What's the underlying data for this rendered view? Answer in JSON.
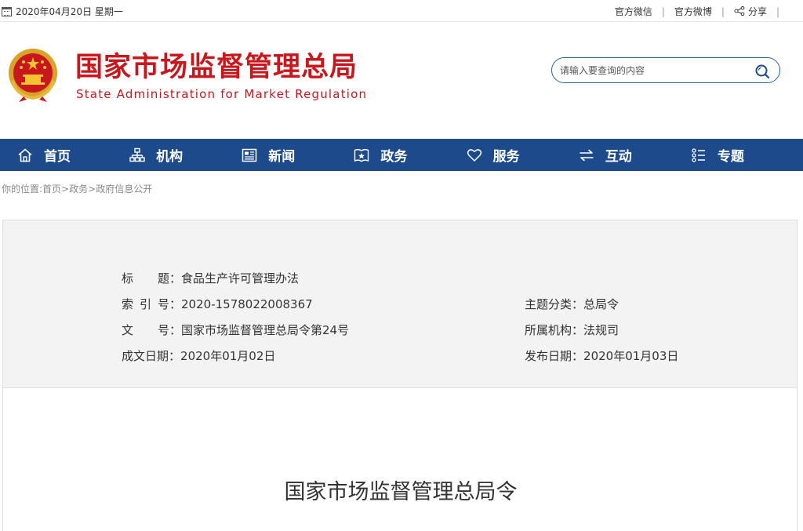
{
  "topbar": {
    "date": "2020年04月20日 星期一",
    "links": [
      "官方微信",
      "官方微博",
      "分享"
    ],
    "icons": {
      "date": "calendar-icon",
      "share": "share-icon"
    }
  },
  "header": {
    "title_cn": "国家市场监督管理总局",
    "title_en": "State Administration for Market Regulation",
    "emblem": "national-emblem",
    "brand_color": "#c8181e"
  },
  "search": {
    "placeholder": "请输入要查询的内容",
    "value": "",
    "icon": "search-icon",
    "border_color": "#2a61a8"
  },
  "nav": {
    "background": "#1c4a8a",
    "items": [
      {
        "label": "首页",
        "icon": "home-icon"
      },
      {
        "label": "机构",
        "icon": "org-chart-icon"
      },
      {
        "label": "新闻",
        "icon": "newspaper-icon"
      },
      {
        "label": "政务",
        "icon": "document-icon"
      },
      {
        "label": "服务",
        "icon": "heart-icon"
      },
      {
        "label": "互动",
        "icon": "exchange-icon"
      },
      {
        "label": "专题",
        "icon": "list-icon"
      }
    ]
  },
  "breadcrumb": {
    "prefix": "你的位置:",
    "items": [
      "首页",
      "政务",
      "政府信息公开"
    ],
    "separator": ">"
  },
  "info": {
    "title": {
      "label": "标题",
      "value": "食品生产许可管理办法"
    },
    "index_no": {
      "label": "索引号",
      "value": "2020-1578022008367"
    },
    "category": {
      "label": "主题分类",
      "value": "总局令"
    },
    "doc_no": {
      "label": "文号",
      "value": "国家市场监督管理总局令第24号"
    },
    "agency": {
      "label": "所属机构",
      "value": "法规司"
    },
    "created": {
      "label": "成文日期",
      "value": "2020年01月02日"
    },
    "published": {
      "label": "发布日期",
      "value": "2020年01月03日"
    },
    "colon": "："
  },
  "content": {
    "heading": "国家市场监督管理总局令"
  }
}
